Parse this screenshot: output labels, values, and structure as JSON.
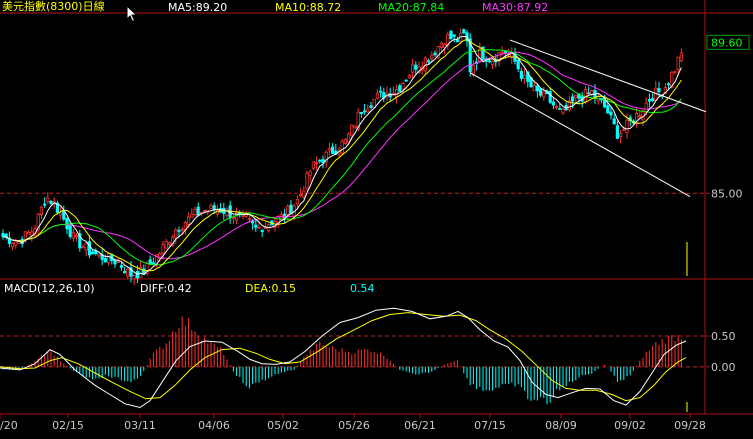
{
  "chart_data": [
    {
      "type": "candlestick",
      "title": "美元指數(8300)日線",
      "legend": [
        {
          "label": "MA5:89.20",
          "color": "#ffffff"
        },
        {
          "label": "MA10:88.72",
          "color": "#ffff00"
        },
        {
          "label": "MA20:87.84",
          "color": "#00ff00"
        },
        {
          "label": "MA30:87.92",
          "color": "#ff33ff"
        }
      ],
      "y_ticks": [
        {
          "value": 85.0,
          "label": "85.00"
        }
      ],
      "last_price": {
        "value": 89.6,
        "label": "89.60"
      },
      "ylim": [
        82.4,
        90.5
      ],
      "x_ticks": [
        "/20",
        "02/15",
        "03/11",
        "04/06",
        "05/02",
        "05/26",
        "06/21",
        "07/15",
        "08/09",
        "09/02",
        "09/28"
      ],
      "close_path": [
        [
          0,
          83.7
        ],
        [
          18,
          83.5
        ],
        [
          34,
          83.9
        ],
        [
          46,
          84.9
        ],
        [
          54,
          84.7
        ],
        [
          64,
          84.2
        ],
        [
          74,
          83.6
        ],
        [
          90,
          83.2
        ],
        [
          106,
          83.0
        ],
        [
          118,
          82.9
        ],
        [
          130,
          82.5
        ],
        [
          144,
          82.6
        ],
        [
          160,
          83.2
        ],
        [
          176,
          83.9
        ],
        [
          192,
          84.3
        ],
        [
          206,
          84.5
        ],
        [
          222,
          84.5
        ],
        [
          236,
          84.3
        ],
        [
          246,
          84.2
        ],
        [
          256,
          83.9
        ],
        [
          270,
          84.1
        ],
        [
          284,
          84.3
        ],
        [
          298,
          84.8
        ],
        [
          312,
          85.8
        ],
        [
          328,
          86.2
        ],
        [
          346,
          86.6
        ],
        [
          362,
          87.6
        ],
        [
          380,
          88.0
        ],
        [
          398,
          88.2
        ],
        [
          414,
          88.9
        ],
        [
          430,
          89.2
        ],
        [
          446,
          89.8
        ],
        [
          458,
          89.7
        ],
        [
          466,
          89.9
        ],
        [
          470,
          88.8
        ],
        [
          480,
          89.3
        ],
        [
          492,
          89.1
        ],
        [
          504,
          89.4
        ],
        [
          514,
          89.1
        ],
        [
          524,
          88.5
        ],
        [
          536,
          88.1
        ],
        [
          548,
          87.9
        ],
        [
          562,
          87.4
        ],
        [
          576,
          87.9
        ],
        [
          592,
          88.1
        ],
        [
          606,
          87.6
        ],
        [
          618,
          86.8
        ],
        [
          628,
          87.1
        ],
        [
          640,
          87.5
        ],
        [
          652,
          88.0
        ],
        [
          664,
          88.2
        ],
        [
          676,
          88.9
        ],
        [
          684,
          89.6
        ]
      ],
      "channel": [
        {
          "from": [
            470,
            88.7
          ],
          "to": [
            690,
            84.9
          ]
        },
        {
          "from": [
            510,
            89.7
          ],
          "to": [
            706,
            87.5
          ]
        }
      ]
    },
    {
      "type": "macd",
      "title": "MACD(12,26,10)",
      "legend": [
        {
          "label": "DIFF:0.42",
          "color": "#ffffff"
        },
        {
          "label": "DEA:0.15",
          "color": "#ffff00"
        },
        {
          "label": "0.54",
          "color": "#00ffff"
        }
      ],
      "y_ticks": [
        {
          "value": 0.5,
          "label": "0.50"
        },
        {
          "value": 0.0,
          "label": "0.00"
        }
      ],
      "ylim": [
        -0.75,
        1.15
      ],
      "diff_path": [
        [
          0,
          -0.02
        ],
        [
          20,
          -0.05
        ],
        [
          35,
          0.05
        ],
        [
          50,
          0.28
        ],
        [
          60,
          0.2
        ],
        [
          75,
          -0.05
        ],
        [
          95,
          -0.3
        ],
        [
          110,
          -0.45
        ],
        [
          125,
          -0.6
        ],
        [
          140,
          -0.66
        ],
        [
          150,
          -0.55
        ],
        [
          162,
          -0.25
        ],
        [
          176,
          0.1
        ],
        [
          190,
          0.33
        ],
        [
          205,
          0.42
        ],
        [
          222,
          0.4
        ],
        [
          238,
          0.25
        ],
        [
          250,
          0.12
        ],
        [
          262,
          0.05
        ],
        [
          276,
          0.04
        ],
        [
          290,
          0.08
        ],
        [
          305,
          0.25
        ],
        [
          322,
          0.5
        ],
        [
          340,
          0.72
        ],
        [
          358,
          0.8
        ],
        [
          376,
          0.92
        ],
        [
          394,
          0.95
        ],
        [
          412,
          0.9
        ],
        [
          430,
          0.78
        ],
        [
          446,
          0.82
        ],
        [
          458,
          0.9
        ],
        [
          468,
          0.8
        ],
        [
          480,
          0.6
        ],
        [
          494,
          0.42
        ],
        [
          508,
          0.32
        ],
        [
          520,
          0.1
        ],
        [
          532,
          -0.25
        ],
        [
          546,
          -0.45
        ],
        [
          558,
          -0.5
        ],
        [
          572,
          -0.42
        ],
        [
          586,
          -0.35
        ],
        [
          600,
          -0.36
        ],
        [
          614,
          -0.55
        ],
        [
          626,
          -0.62
        ],
        [
          640,
          -0.4
        ],
        [
          652,
          -0.1
        ],
        [
          664,
          0.2
        ],
        [
          676,
          0.35
        ],
        [
          686,
          0.42
        ]
      ],
      "dea_path": [
        [
          0,
          0.0
        ],
        [
          20,
          -0.03
        ],
        [
          35,
          -0.02
        ],
        [
          50,
          0.1
        ],
        [
          62,
          0.15
        ],
        [
          78,
          0.05
        ],
        [
          95,
          -0.1
        ],
        [
          112,
          -0.25
        ],
        [
          130,
          -0.4
        ],
        [
          146,
          -0.52
        ],
        [
          160,
          -0.5
        ],
        [
          175,
          -0.3
        ],
        [
          190,
          -0.05
        ],
        [
          205,
          0.15
        ],
        [
          222,
          0.28
        ],
        [
          240,
          0.3
        ],
        [
          256,
          0.22
        ],
        [
          270,
          0.12
        ],
        [
          285,
          0.05
        ],
        [
          300,
          0.08
        ],
        [
          318,
          0.25
        ],
        [
          336,
          0.45
        ],
        [
          354,
          0.6
        ],
        [
          372,
          0.75
        ],
        [
          390,
          0.85
        ],
        [
          408,
          0.88
        ],
        [
          426,
          0.85
        ],
        [
          444,
          0.82
        ],
        [
          460,
          0.84
        ],
        [
          476,
          0.75
        ],
        [
          490,
          0.6
        ],
        [
          506,
          0.45
        ],
        [
          522,
          0.25
        ],
        [
          538,
          0.0
        ],
        [
          552,
          -0.22
        ],
        [
          566,
          -0.35
        ],
        [
          580,
          -0.38
        ],
        [
          596,
          -0.38
        ],
        [
          612,
          -0.45
        ],
        [
          626,
          -0.55
        ],
        [
          640,
          -0.5
        ],
        [
          654,
          -0.3
        ],
        [
          666,
          -0.08
        ],
        [
          678,
          0.08
        ],
        [
          686,
          0.15
        ]
      ],
      "histogram_envelope": [
        [
          0,
          -0.04
        ],
        [
          20,
          -0.05
        ],
        [
          36,
          0.1
        ],
        [
          48,
          0.3
        ],
        [
          58,
          0.15
        ],
        [
          72,
          -0.05
        ],
        [
          90,
          -0.2
        ],
        [
          108,
          -0.15
        ],
        [
          126,
          -0.25
        ],
        [
          140,
          -0.2
        ],
        [
          152,
          0.2
        ],
        [
          166,
          0.4
        ],
        [
          180,
          0.8
        ],
        [
          192,
          0.7
        ],
        [
          206,
          0.45
        ],
        [
          222,
          0.28
        ],
        [
          236,
          -0.15
        ],
        [
          250,
          -0.35
        ],
        [
          264,
          -0.22
        ],
        [
          280,
          -0.1
        ],
        [
          294,
          -0.05
        ],
        [
          306,
          0.2
        ],
        [
          320,
          0.4
        ],
        [
          336,
          0.3
        ],
        [
          352,
          0.25
        ],
        [
          370,
          0.3
        ],
        [
          386,
          0.18
        ],
        [
          400,
          -0.05
        ],
        [
          416,
          -0.15
        ],
        [
          432,
          -0.08
        ],
        [
          446,
          0.05
        ],
        [
          458,
          0.1
        ],
        [
          468,
          -0.25
        ],
        [
          484,
          -0.4
        ],
        [
          500,
          -0.35
        ],
        [
          516,
          -0.3
        ],
        [
          530,
          -0.55
        ],
        [
          546,
          -0.6
        ],
        [
          560,
          -0.4
        ],
        [
          576,
          -0.2
        ],
        [
          592,
          -0.1
        ],
        [
          606,
          0.05
        ],
        [
          618,
          -0.25
        ],
        [
          630,
          -0.15
        ],
        [
          644,
          0.2
        ],
        [
          656,
          0.4
        ],
        [
          670,
          0.5
        ],
        [
          684,
          0.54
        ]
      ]
    }
  ],
  "colors": {
    "up": "#ff3030",
    "down": "#00ffff",
    "axis": "#b01010",
    "dashed": "#c02020",
    "label": "#c8c8c8",
    "ma5": "#ffffff",
    "ma10": "#ffff00",
    "ma20": "#00ff00",
    "ma30": "#ff33ff"
  }
}
